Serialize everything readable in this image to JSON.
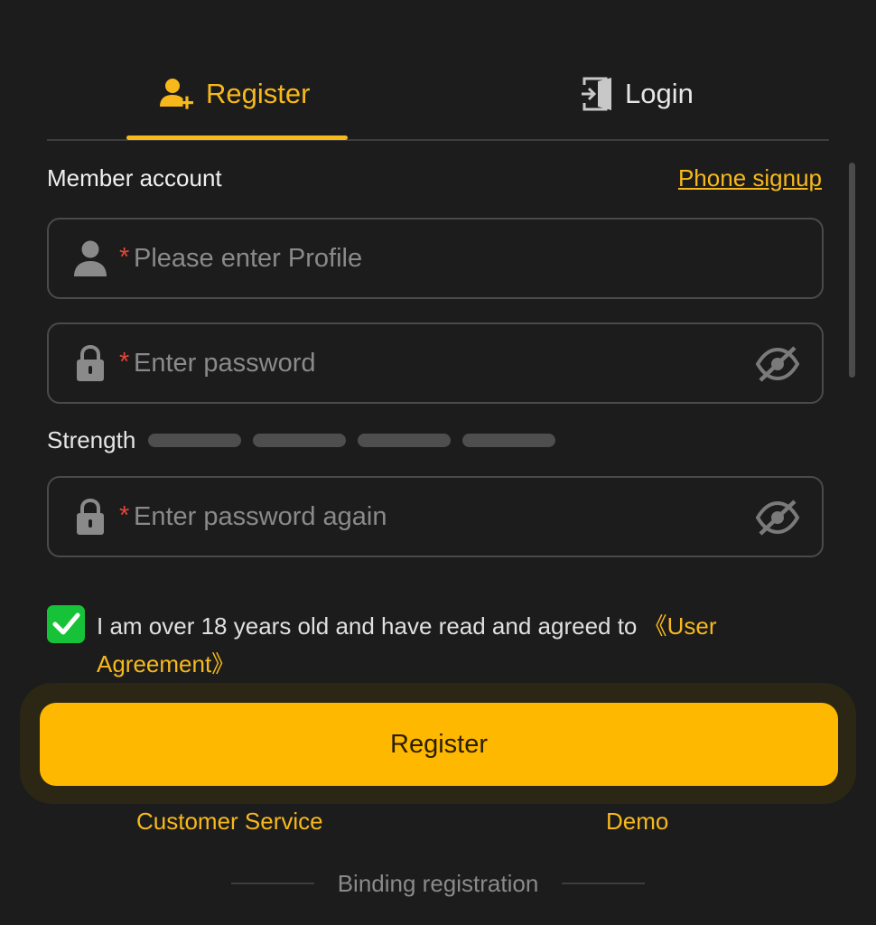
{
  "tabs": {
    "register_label": "Register",
    "login_label": "Login",
    "active": "Register"
  },
  "section": {
    "title": "Member account",
    "phone_link": "Phone signup"
  },
  "fields": {
    "profile": {
      "placeholder": "Please enter Profile",
      "value": "",
      "required_mark": "*"
    },
    "password": {
      "placeholder": "Enter password",
      "value": "",
      "required_mark": "*"
    },
    "password_again": {
      "placeholder": "Enter password again",
      "value": "",
      "required_mark": "*"
    }
  },
  "strength": {
    "label": "Strength",
    "segments": 4,
    "level": 0
  },
  "agreement": {
    "checked": true,
    "text": "I am over 18 years old and have read and agreed to ",
    "link": "《User Agreement》"
  },
  "register_button": "Register",
  "footer": {
    "customer_service": "Customer Service",
    "demo": "Demo",
    "binding": "Binding registration"
  },
  "colors": {
    "accent": "#f7b81c",
    "button": "#ffb800",
    "background": "#1c1c1c",
    "checkbox": "#16c338",
    "required": "#e0473a"
  },
  "icons": {
    "register_tab": "user-add-icon",
    "login_tab": "login-door-icon",
    "profile_field": "user-icon",
    "password_field": "lock-icon",
    "password_toggle": "eye-off-icon",
    "checkbox": "checkmark-icon"
  }
}
